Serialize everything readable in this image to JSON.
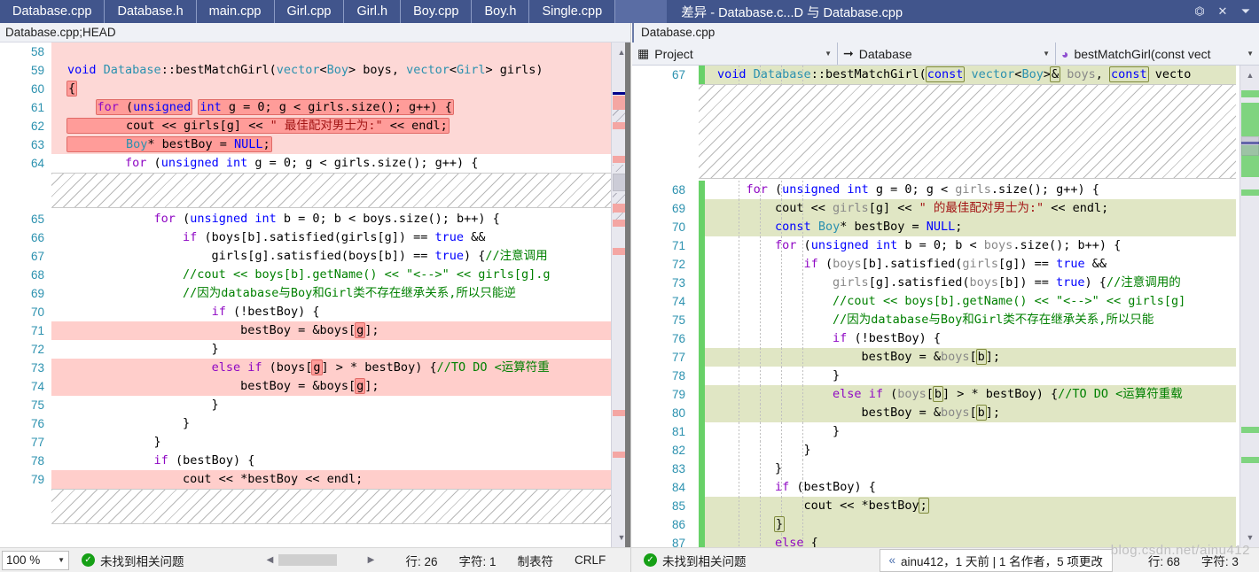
{
  "tabs": [
    {
      "label": "Database.cpp",
      "active": true
    },
    {
      "label": "Database.h",
      "active": false
    },
    {
      "label": "main.cpp",
      "active": false
    },
    {
      "label": "Girl.cpp",
      "active": false
    },
    {
      "label": "Girl.h",
      "active": false
    },
    {
      "label": "Boy.cpp",
      "active": false
    },
    {
      "label": "Boy.h",
      "active": false
    },
    {
      "label": "Single.cpp",
      "active": false
    }
  ],
  "diff_tab": {
    "label": "差异 - Database.c...D 与 Database.cpp",
    "float_icon": "float-window-icon",
    "close_icon": "close-icon",
    "overflow_icon": "chevron-down-icon"
  },
  "left_pane": {
    "caption": "Database.cpp;HEAD",
    "lines": [
      {
        "num": "58",
        "state": "del-soft",
        "code": ""
      },
      {
        "num": "59",
        "state": "del-soft",
        "code": "void Database::bestMatchGirl(vector<Boy> boys, vector<Girl> girls)"
      },
      {
        "num": "60",
        "state": "del-soft",
        "code": "{"
      },
      {
        "num": "61",
        "state": "del-soft",
        "code": "    for (unsigned int g = 0; g < girls.size(); g++) {"
      },
      {
        "num": "62",
        "state": "del-soft",
        "code": "        cout << girls[g] << \" 最佳配对男士为:\" << endl;"
      },
      {
        "num": "63",
        "state": "del-soft",
        "code": "        Boy* bestBoy = NULL;"
      },
      {
        "num": "64",
        "state": "none",
        "code": "        for (unsigned int g = 0; g < girls.size(); g++) {"
      },
      {
        "num": "",
        "state": "hatch",
        "code": ""
      },
      {
        "num": "65",
        "state": "none",
        "code": "            for (unsigned int b = 0; b < boys.size(); b++) {"
      },
      {
        "num": "66",
        "state": "none",
        "code": "                if (boys[b].satisfied(girls[g]) == true &&"
      },
      {
        "num": "67",
        "state": "none",
        "code": "                    girls[g].satisfied(boys[b]) == true) {//注意调用"
      },
      {
        "num": "68",
        "state": "none",
        "code": "                //cout << boys[b].getName() << \"<-->\" << girls[g].g"
      },
      {
        "num": "69",
        "state": "none",
        "code": "                //因为database与Boy和Girl类不存在继承关系,所以只能逆"
      },
      {
        "num": "70",
        "state": "none",
        "code": "                    if (!bestBoy) {"
      },
      {
        "num": "71",
        "state": "del",
        "code": "                        bestBoy = &boys[g];"
      },
      {
        "num": "72",
        "state": "none",
        "code": "                    }"
      },
      {
        "num": "73",
        "state": "del",
        "code": "                    else if (boys[g] > * bestBoy) {//TO DO <运算符重"
      },
      {
        "num": "74",
        "state": "del",
        "code": "                        bestBoy = &boys[g];"
      },
      {
        "num": "75",
        "state": "none",
        "code": "                    }"
      },
      {
        "num": "76",
        "state": "none",
        "code": "                }"
      },
      {
        "num": "77",
        "state": "none",
        "code": "            }"
      },
      {
        "num": "78",
        "state": "none",
        "code": "            if (bestBoy) {"
      },
      {
        "num": "79",
        "state": "del",
        "code": "                cout << *bestBoy << endl;"
      },
      {
        "num": "",
        "state": "hatch",
        "code": ""
      }
    ]
  },
  "right_pane": {
    "caption": "Database.cpp",
    "nav": {
      "project": "Project",
      "project_icon": "project-icon",
      "scope": "Database",
      "scope_icon": "arrow-right-icon",
      "member": "bestMatchGirl(const vect",
      "member_icon": "method-icon",
      "caret_icon": "chevron-down-icon"
    },
    "lines": [
      {
        "num": "67",
        "state": "add-line",
        "code": "void Database::bestMatchGirl(const vector<Boy>& boys, const vecto"
      },
      {
        "num": "",
        "state": "hatch",
        "code": ""
      },
      {
        "num": "68",
        "state": "add-none",
        "code": "    for (unsigned int g = 0; g < girls.size(); g++) {"
      },
      {
        "num": "69",
        "state": "add",
        "code": "        cout << girls[g] << \" 的最佳配对男士为:\" << endl;"
      },
      {
        "num": "70",
        "state": "add",
        "code": "        const Boy* bestBoy = NULL;"
      },
      {
        "num": "71",
        "state": "add-none",
        "code": "        for (unsigned int b = 0; b < boys.size(); b++) {"
      },
      {
        "num": "72",
        "state": "add-none",
        "code": "            if (boys[b].satisfied(girls[g]) == true &&"
      },
      {
        "num": "73",
        "state": "add-none",
        "code": "                girls[g].satisfied(boys[b]) == true) {//注意调用的"
      },
      {
        "num": "74",
        "state": "add-none",
        "code": "                //cout << boys[b].getName() << \"<-->\" << girls[g]"
      },
      {
        "num": "75",
        "state": "add-none",
        "code": "                //因为database与Boy和Girl类不存在继承关系,所以只能"
      },
      {
        "num": "76",
        "state": "add-none",
        "code": "                if (!bestBoy) {"
      },
      {
        "num": "77",
        "state": "add",
        "code": "                    bestBoy = &boys[b];"
      },
      {
        "num": "78",
        "state": "add-none",
        "code": "                }"
      },
      {
        "num": "79",
        "state": "add",
        "code": "                else if (boys[b] > * bestBoy) {//TO DO <运算符重载"
      },
      {
        "num": "80",
        "state": "add",
        "code": "                    bestBoy = &boys[b];"
      },
      {
        "num": "81",
        "state": "add-none",
        "code": "                }"
      },
      {
        "num": "82",
        "state": "add-none",
        "code": "            }"
      },
      {
        "num": "83",
        "state": "add-none",
        "code": "        }"
      },
      {
        "num": "84",
        "state": "add-none",
        "code": "        if (bestBoy) {"
      },
      {
        "num": "85",
        "state": "add",
        "code": "            cout << *bestBoy;"
      },
      {
        "num": "86",
        "state": "add",
        "code": "        }"
      },
      {
        "num": "87",
        "state": "add",
        "code": "        else {"
      }
    ]
  },
  "status_bar": {
    "zoom": "100 %",
    "zoom_caret_icon": "chevron-down-icon",
    "left_issue_icon": "check-circle-icon",
    "left_issues": "未找到相关问题",
    "scroll_left_icon": "triangle-left-icon",
    "scroll_right_icon": "triangle-right-icon",
    "left_line_label": "行: 26",
    "left_col_label": "字符: 1",
    "left_indent": "制表符",
    "left_eol": "CRLF",
    "right_issue_icon": "check-circle-icon",
    "right_issues": "未找到相关问题",
    "author_icon": "codelens-icon",
    "author_info": "ainu412，1 天前 | 1 名作者，5 项更改",
    "right_line_label": "行: 68",
    "right_col_label": "字符: 3"
  },
  "watermark": "blog.csdn.net/ainu412",
  "colors": {
    "tab_bar": "#41558c",
    "delete_bg": "#ffcecb",
    "delete_token": "#ff9c99",
    "add_bg": "#e0e6c4",
    "add_token": "#dce3be",
    "change_bar": "#68d168",
    "line_number": "#2b91af"
  }
}
